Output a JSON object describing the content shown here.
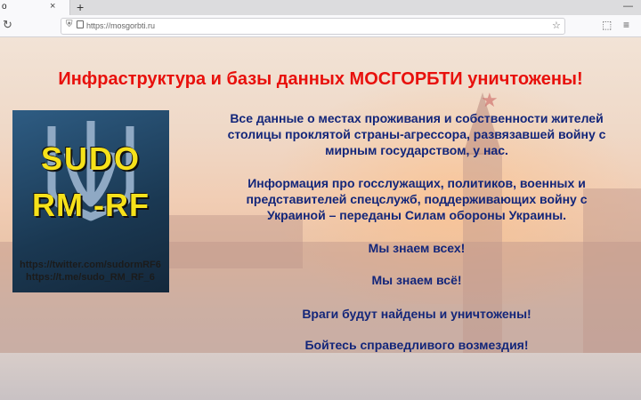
{
  "browser": {
    "tab_title": "о",
    "tab_close": "×",
    "new_tab": "+",
    "window_minimize": "—",
    "url": "https://mosgorbti.ru"
  },
  "page": {
    "headline": "Инфраструктура и базы данных МОСГОРБТИ уничтожены!",
    "logo": {
      "line1": "SUDO",
      "line2": "RM -RF"
    },
    "links": [
      "https://twitter.com/sudormRF6",
      "https://t.me/sudo_RM_RF_6"
    ],
    "paragraph1": [
      "Все данные о местах проживания и собственности жителей",
      "столицы проклятой страны-агрессора, развязавшей войну с",
      "мирным государством, у нас."
    ],
    "paragraph2": [
      "Информация про госслужащих, политиков, военных и",
      "представителей спецслужб, поддерживающих войну с",
      "Украиной – переданы Силам обороны Украины."
    ],
    "line_know_all": "Мы знаем всех!",
    "line_know_everything": "Мы знаем всё!",
    "line_enemies": "Враги будут найдены и уничтожены!",
    "line_fear": "Бойтесь справедливого возмездия!"
  },
  "colors": {
    "headline": "#e8100c",
    "body_text": "#13267a",
    "logo_text": "#f6e11a",
    "logo_bg": "#1a3852"
  },
  "icons": [
    "reload-icon",
    "shield-icon",
    "lock-icon",
    "star-bookmark-icon",
    "pocket-icon",
    "menu-icon"
  ]
}
